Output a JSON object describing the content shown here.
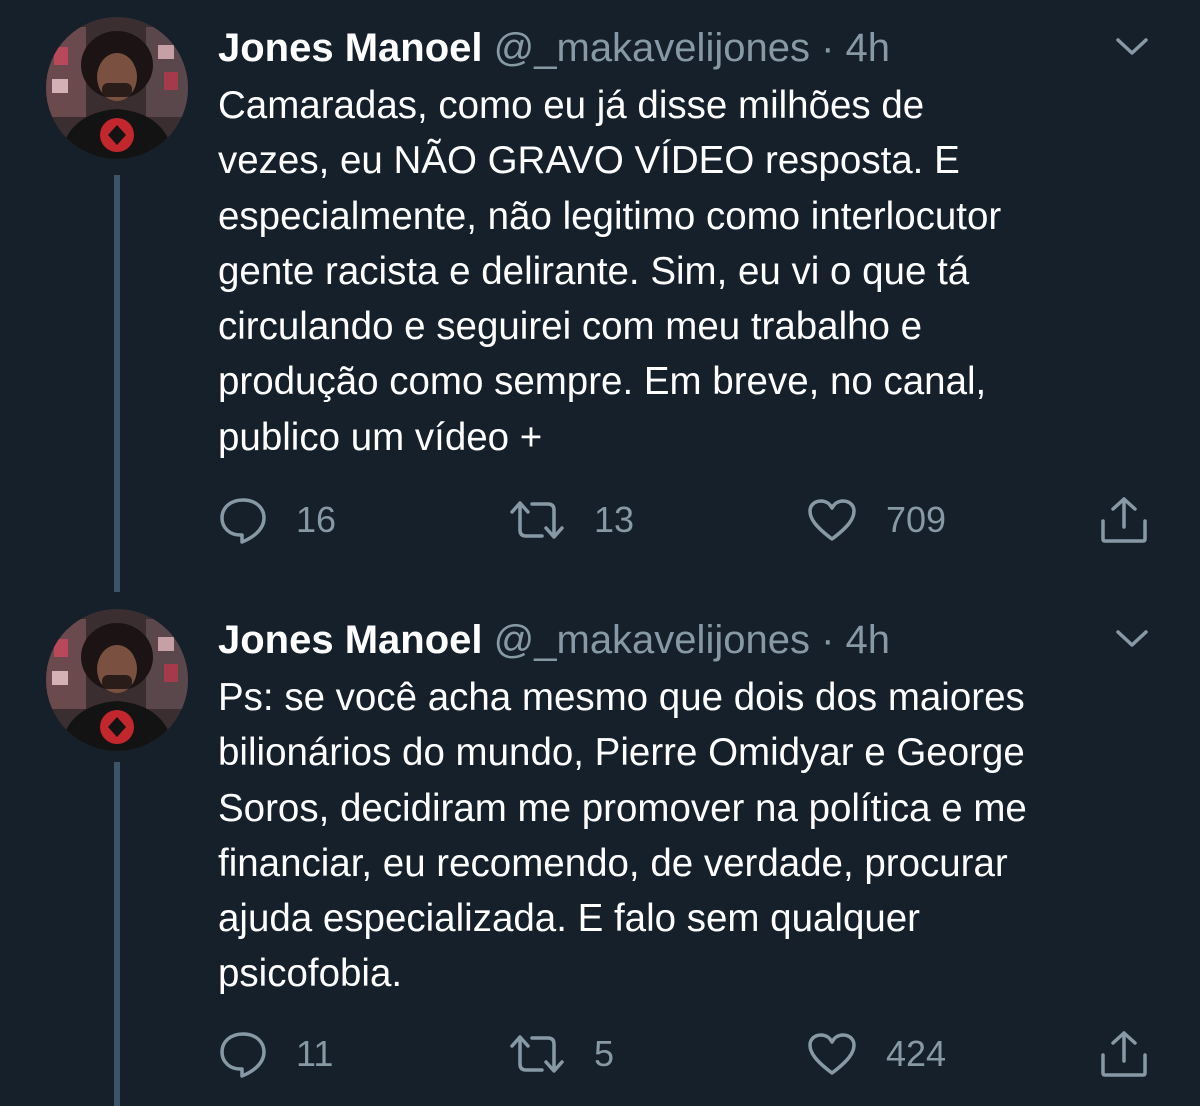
{
  "tweets": [
    {
      "name": "Jones Manoel",
      "handle": "@_makavelijones",
      "separator": "·",
      "time": "4h",
      "text": "Camaradas, como eu já disse milhões de\nvezes, eu NÃO GRAVO VÍDEO resposta. E\nespecialmente, não legitimo como interlocutor\ngente racista e delirante. Sim, eu vi o que tá\ncirculando e seguirei com meu trabalho e\nprodução como sempre. Em breve, no canal,\npublico um vídeo +",
      "replies": "16",
      "retweets": "13",
      "likes": "709"
    },
    {
      "name": "Jones Manoel",
      "handle": "@_makavelijones",
      "separator": "·",
      "time": "4h",
      "text": "Ps: se você acha mesmo que dois dos maiores\nbilionários do mundo, Pierre Omidyar e George\nSoros, decidiram me promover na política e me\nfinanciar, eu recomendo, de verdade, procurar\najuda especializada. E falo sem qualquer\npsicofobia.",
      "replies": "11",
      "retweets": "5",
      "likes": "424"
    }
  ],
  "icons": {
    "reply": "speech-bubble-icon",
    "retweet": "retweet-arrows-icon",
    "like": "heart-icon",
    "share": "share-upload-icon",
    "menu": "chevron-down-icon"
  },
  "colors": {
    "background": "#15202b",
    "text": "#ffffff",
    "muted": "#8899a6",
    "thread_line": "#3d5466"
  }
}
